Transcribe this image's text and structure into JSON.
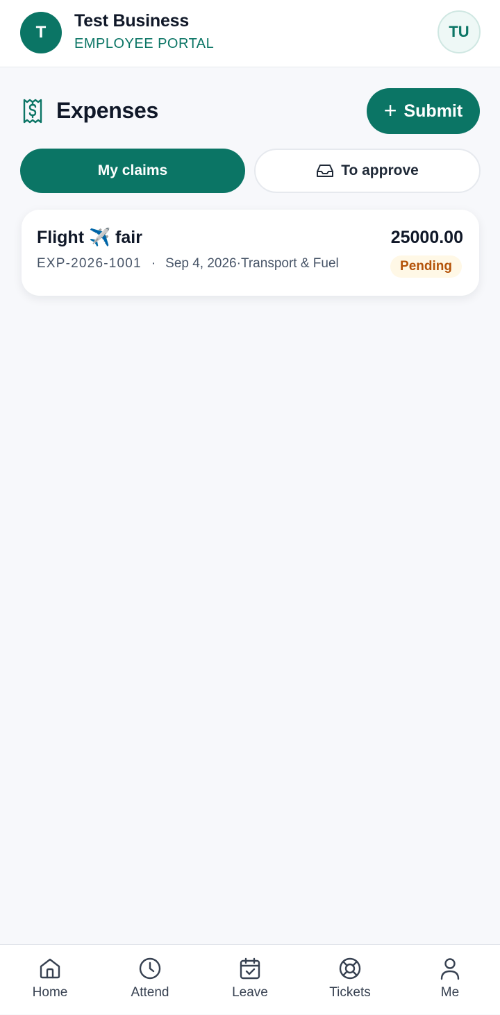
{
  "header": {
    "avatar_letter": "T",
    "business_name": "Test Business",
    "portal_label": "EMPLOYEE PORTAL",
    "user_initials": "TU"
  },
  "section": {
    "icon": "receipt-icon",
    "title": "Expenses",
    "submit_label": "Submit"
  },
  "tabs": [
    {
      "label": "My claims",
      "active": true
    },
    {
      "label": "To approve",
      "active": false,
      "icon": "inbox-icon"
    }
  ],
  "claims": [
    {
      "title": "Flight ✈️ fair",
      "amount": "25000.00",
      "code": "EXP-2026-1001",
      "separator": "·",
      "date": "Sep 4, 2026",
      "category_separator": "·",
      "category": "Transport & Fuel",
      "status": "Pending"
    }
  ],
  "nav": [
    {
      "label": "Home",
      "icon": "home-icon"
    },
    {
      "label": "Attend",
      "icon": "clock-icon"
    },
    {
      "label": "Leave",
      "icon": "calendar-check-icon"
    },
    {
      "label": "Tickets",
      "icon": "lifebuoy-icon"
    },
    {
      "label": "Me",
      "icon": "user-icon"
    }
  ],
  "colors": {
    "primary": "#0b7565",
    "pending_text": "#b45309",
    "pending_bg": "#fff8e6",
    "background": "#f7f8fb"
  }
}
